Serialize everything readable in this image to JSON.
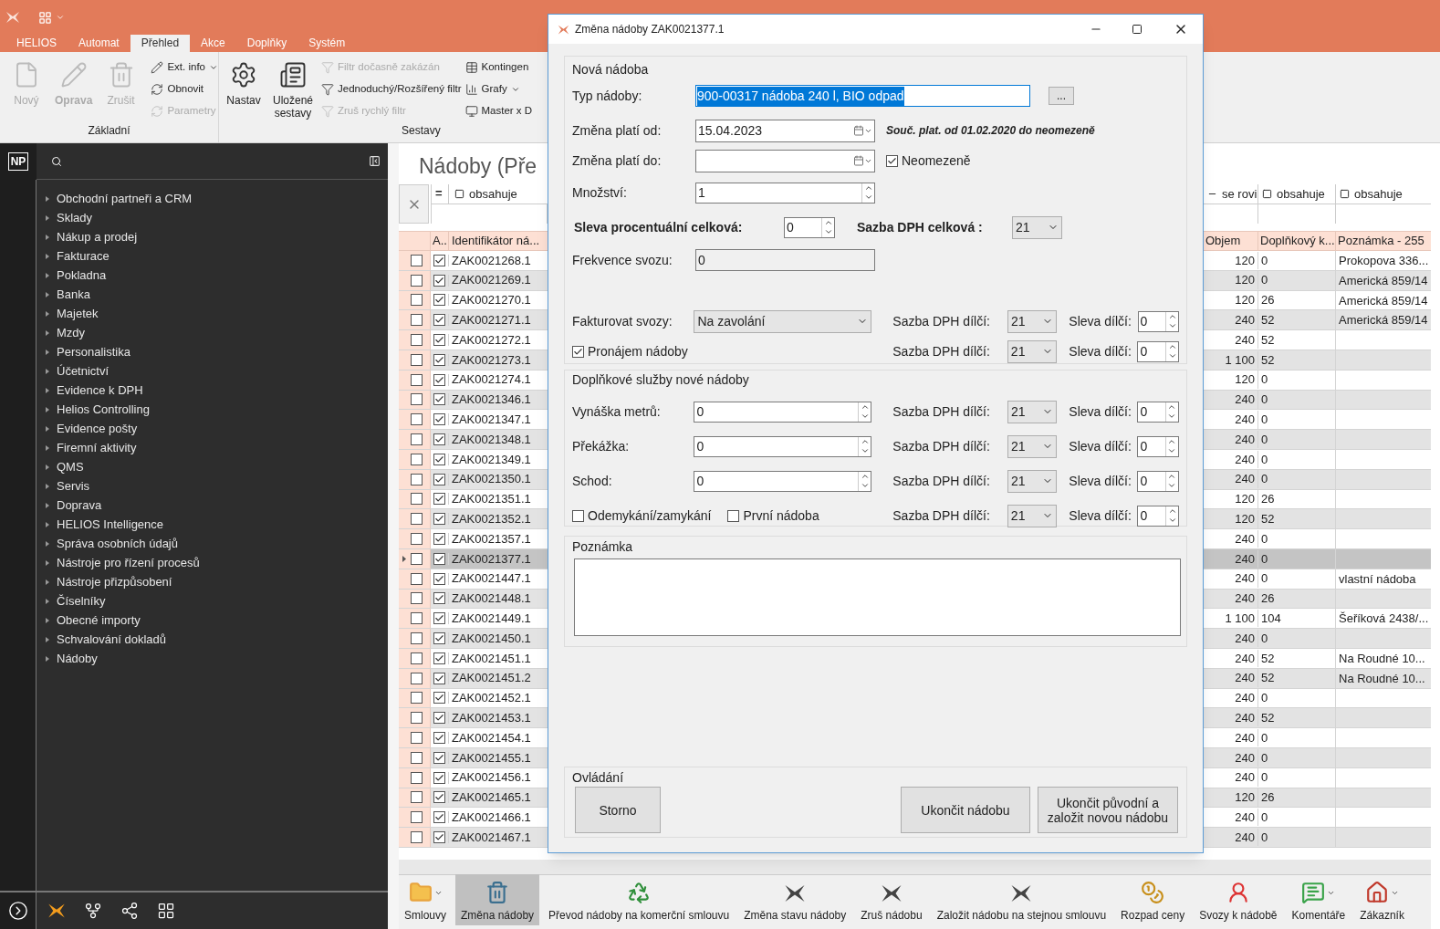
{
  "ribbon": {
    "tabs": [
      {
        "label": "HELIOS",
        "selected": false
      },
      {
        "label": "Automat",
        "selected": false
      },
      {
        "label": "Přehled",
        "selected": true
      },
      {
        "label": "Akce",
        "selected": false
      },
      {
        "label": "Doplňky",
        "selected": false
      },
      {
        "label": "Systém",
        "selected": false
      }
    ],
    "groups": [
      {
        "label": "Základní",
        "large": [
          {
            "label": "Nový",
            "kind": "file",
            "disabled": true
          },
          {
            "label": "Oprava",
            "kind": "pencil",
            "disabled": true
          },
          {
            "label": "Zrušit",
            "kind": "trash",
            "disabled": true
          }
        ],
        "small": [
          {
            "label": "Ext. info",
            "kind": "pencil",
            "disabled": false,
            "dropdown": true
          },
          {
            "label": "Obnovit",
            "kind": "refresh",
            "disabled": false,
            "dropdown": false
          },
          {
            "label": "Parametry",
            "kind": "refresh",
            "disabled": true,
            "dropdown": false
          }
        ]
      },
      {
        "label": "Sestavy",
        "large": [
          {
            "label": "Nastav",
            "kind": "gear",
            "disabled": false
          },
          {
            "label": "Uložené sestavy",
            "kind": "report",
            "disabled": false
          }
        ],
        "small": [
          {
            "label": "Filtr dočasně zakázán",
            "kind": "filter",
            "disabled": true,
            "dropdown": false
          },
          {
            "label": "Jednoduchý/Rozšířený filtr",
            "kind": "filter",
            "disabled": false,
            "dropdown": false
          },
          {
            "label": "Zruš rychlý filtr",
            "kind": "filter",
            "disabled": true,
            "dropdown": false
          }
        ],
        "small2": [
          {
            "label": "Kontingen",
            "kind": "table",
            "disabled": false,
            "dropdown": false
          },
          {
            "label": "Grafy",
            "kind": "chart",
            "disabled": false,
            "dropdown": true
          },
          {
            "label": "Master x D",
            "kind": "monitor",
            "disabled": false,
            "dropdown": false
          }
        ]
      }
    ]
  },
  "sidebar": {
    "badge": "NP",
    "items": [
      "Obchodní partneři a CRM",
      "Sklady",
      "Nákup a prodej",
      "Fakturace",
      "Pokladna",
      "Banka",
      "Majetek",
      "Mzdy",
      "Personalistika",
      "Účetnictví",
      "Evidence k DPH",
      "Helios Controlling",
      "Evidence pošty",
      "Firemní aktivity",
      "QMS",
      "Servis",
      "Doprava",
      "HELIOS Intelligence",
      "Správa osobních údajů",
      "Nástroje pro řízení procesů",
      "Nástroje přizpůsobení",
      "Číselníky",
      "Obecné importy",
      "Schvalování dokladů",
      "Nádoby"
    ]
  },
  "main": {
    "title": "Nádoby (Pře"
  },
  "table": {
    "filters_left": [
      "=",
      "obsahuje"
    ],
    "filters_right": [
      "se rovi",
      "obsahuje",
      "obsahuje"
    ],
    "columns_left": [
      "A..",
      "Identifikátor ná..."
    ],
    "columns_right": [
      "Objem",
      "Doplňkový k...",
      "Poznámka - 255"
    ],
    "rows": [
      {
        "id": "ZAK0021268.1",
        "volume": "120",
        "extra": "0",
        "note": "Prokopova 336...",
        "marked": false,
        "checked": true,
        "selected": false
      },
      {
        "id": "ZAK0021269.1",
        "volume": "120",
        "extra": "0",
        "note": "Americká 859/14",
        "marked": false,
        "checked": true,
        "selected": false
      },
      {
        "id": "ZAK0021270.1",
        "volume": "120",
        "extra": "26",
        "note": "Americká 859/14",
        "marked": false,
        "checked": true,
        "selected": false
      },
      {
        "id": "ZAK0021271.1",
        "volume": "240",
        "extra": "52",
        "note": "Americká 859/14",
        "marked": false,
        "checked": true,
        "selected": false
      },
      {
        "id": "ZAK0021272.1",
        "volume": "240",
        "extra": "52",
        "marked": false,
        "checked": true,
        "selected": false
      },
      {
        "id": "ZAK0021273.1",
        "volume": "1 100",
        "extra": "52",
        "marked": false,
        "checked": true,
        "selected": false
      },
      {
        "id": "ZAK0021274.1",
        "volume": "120",
        "extra": "0",
        "marked": false,
        "checked": true,
        "selected": false
      },
      {
        "id": "ZAK0021346.1",
        "volume": "240",
        "extra": "0",
        "marked": false,
        "checked": true,
        "selected": false
      },
      {
        "id": "ZAK0021347.1",
        "volume": "240",
        "extra": "0",
        "marked": false,
        "checked": true,
        "selected": false
      },
      {
        "id": "ZAK0021348.1",
        "volume": "240",
        "extra": "0",
        "marked": false,
        "checked": true,
        "selected": false
      },
      {
        "id": "ZAK0021349.1",
        "volume": "240",
        "extra": "0",
        "marked": false,
        "checked": true,
        "selected": false
      },
      {
        "id": "ZAK0021350.1",
        "volume": "240",
        "extra": "0",
        "marked": false,
        "checked": true,
        "selected": false
      },
      {
        "id": "ZAK0021351.1",
        "volume": "120",
        "extra": "26",
        "marked": false,
        "checked": true,
        "selected": false
      },
      {
        "id": "ZAK0021352.1",
        "volume": "120",
        "extra": "52",
        "marked": false,
        "checked": true,
        "selected": false
      },
      {
        "id": "ZAK0021357.1",
        "volume": "240",
        "extra": "0",
        "marked": false,
        "checked": true,
        "selected": false
      },
      {
        "id": "ZAK0021377.1",
        "volume": "240",
        "extra": "0",
        "marked": false,
        "checked": true,
        "selected": true
      },
      {
        "id": "ZAK0021447.1",
        "volume": "240",
        "extra": "0",
        "note": "vlastní nádoba",
        "marked": false,
        "checked": true,
        "selected": false
      },
      {
        "id": "ZAK0021448.1",
        "volume": "240",
        "extra": "26",
        "marked": false,
        "checked": true,
        "selected": false
      },
      {
        "id": "ZAK0021449.1",
        "volume": "1 100",
        "extra": "104",
        "note": "Šeříková 2438/...",
        "marked": false,
        "checked": true,
        "selected": false
      },
      {
        "id": "ZAK0021450.1",
        "volume": "240",
        "extra": "0",
        "marked": false,
        "checked": true,
        "selected": false
      },
      {
        "id": "ZAK0021451.1",
        "volume": "240",
        "extra": "52",
        "note": "Na Roudné 10...",
        "marked": false,
        "checked": true,
        "selected": false
      },
      {
        "id": "ZAK0021451.2",
        "volume": "240",
        "extra": "52",
        "note": "Na Roudné 10...",
        "marked": false,
        "checked": true,
        "selected": false
      },
      {
        "id": "ZAK0021452.1",
        "volume": "240",
        "extra": "0",
        "marked": false,
        "checked": true,
        "selected": false
      },
      {
        "id": "ZAK0021453.1",
        "volume": "240",
        "extra": "52",
        "marked": false,
        "checked": true,
        "selected": false
      },
      {
        "id": "ZAK0021454.1",
        "volume": "240",
        "extra": "0",
        "marked": false,
        "checked": true,
        "selected": false
      },
      {
        "id": "ZAK0021455.1",
        "volume": "240",
        "extra": "0",
        "marked": false,
        "checked": true,
        "selected": false
      },
      {
        "id": "ZAK0021456.1",
        "volume": "240",
        "extra": "0",
        "marked": false,
        "checked": true,
        "selected": false
      },
      {
        "id": "ZAK0021465.1",
        "volume": "120",
        "extra": "26",
        "marked": false,
        "checked": true,
        "selected": false
      },
      {
        "id": "ZAK0021466.1",
        "volume": "240",
        "extra": "0",
        "marked": false,
        "checked": true,
        "selected": false
      },
      {
        "id": "ZAK0021467.1",
        "volume": "240",
        "extra": "0",
        "marked": false,
        "checked": true,
        "selected": false
      }
    ]
  },
  "toolbar": [
    {
      "label": "Smlouvy",
      "kind": "folder",
      "selected": false,
      "dropdown": true
    },
    {
      "label": "Změna nádoby",
      "kind": "bin",
      "selected": true,
      "dropdown": false
    },
    {
      "label": "Převod nádoby na komerční smlouvu",
      "kind": "recycle",
      "selected": false,
      "dropdown": false
    },
    {
      "label": "Změna stavu nádoby",
      "kind": "logo",
      "selected": false,
      "dropdown": false
    },
    {
      "label": "Zruš nádobu",
      "kind": "logo",
      "selected": false,
      "dropdown": false
    },
    {
      "label": "Založit nádobu na stejnou smlouvu",
      "kind": "logo",
      "selected": false,
      "dropdown": false
    },
    {
      "label": "Rozpad ceny",
      "kind": "coins",
      "selected": false,
      "dropdown": false
    },
    {
      "label": "Svozy k nádobě",
      "kind": "person",
      "selected": false,
      "dropdown": false
    },
    {
      "label": "Komentáře",
      "kind": "comment",
      "selected": false,
      "dropdown": true
    },
    {
      "label": "Zákazník",
      "kind": "house",
      "selected": false,
      "dropdown": true
    }
  ],
  "dialog": {
    "title": "Změna nádoby ZAK0021377.1",
    "new_container": {
      "legend": "Nová nádoba",
      "type_label": "Typ nádoby:",
      "type_value": "900-00317 nádoba 240 l, BIO odpad",
      "browse": "...",
      "from_label": "Změna platí od:",
      "from_value": "15.04.2023",
      "validity_note": "Souč. plat. od 01.02.2020 do neomezeně",
      "to_label": "Změna platí do:",
      "unlimited": {
        "label": "Neomezeně",
        "checked": true
      },
      "qty_label": "Množství:",
      "qty_value": "1",
      "discount_label": "Sleva procentuální celková:",
      "discount_value": "0",
      "vat_label": "Sazba DPH celková :",
      "vat_value": "21",
      "freq_label": "Frekvence svozu:",
      "freq_value": "0",
      "rows": [
        {
          "kind": "select",
          "label": "Fakturovat svozy:",
          "value": "Na zavolání",
          "vat_label": "Sazba DPH dílčí:",
          "vat": "21",
          "discount_label": "Sleva dílčí:",
          "discount": "0"
        },
        {
          "kind": "checks",
          "checks": [
            {
              "label": "Pronájem nádoby",
              "checked": true
            }
          ],
          "vat_label": "Sazba DPH dílčí:",
          "vat": "21",
          "discount_label": "Sleva dílčí:",
          "discount": "0"
        }
      ]
    },
    "services": {
      "legend": "Doplňkové služby nové nádoby",
      "rows": [
        {
          "kind": "spin",
          "label": "Vynáška metrů:",
          "value": "0",
          "vat_label": "Sazba DPH dílčí:",
          "vat": "21",
          "discount_label": "Sleva dílčí:",
          "discount": "0"
        },
        {
          "kind": "spin",
          "label": "Překážka:",
          "value": "0",
          "vat_label": "Sazba DPH dílčí:",
          "vat": "21",
          "discount_label": "Sleva dílčí:",
          "discount": "0"
        },
        {
          "kind": "spin",
          "label": "Schod:",
          "value": "0",
          "vat_label": "Sazba DPH dílčí:",
          "vat": "21",
          "discount_label": "Sleva dílčí:",
          "discount": "0"
        },
        {
          "kind": "checks",
          "checks": [
            {
              "label": "Odemykání/zamykání",
              "checked": false
            },
            {
              "label": "První nádoba",
              "checked": false
            }
          ],
          "vat_label": "Sazba DPH dílčí:",
          "vat": "21",
          "discount_label": "Sleva dílčí:",
          "discount": "0"
        }
      ]
    },
    "note": {
      "legend": "Poznámka"
    },
    "controls": {
      "legend": "Ovládání",
      "buttons": [
        "Storno",
        "Ukončit nádobu",
        "Ukončit původní a založit novou nádobu"
      ]
    }
  }
}
